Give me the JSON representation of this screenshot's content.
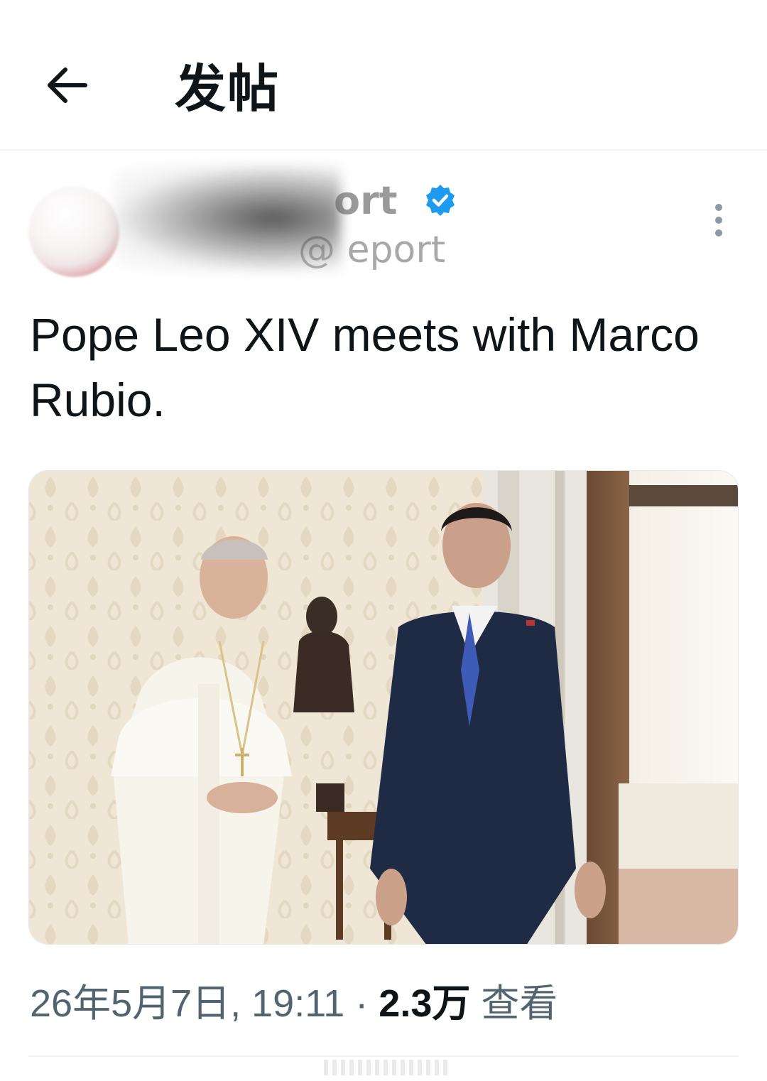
{
  "header": {
    "title": "发帖"
  },
  "author": {
    "name_partial": "ort",
    "handle_partial": "@        eport",
    "verified": true
  },
  "post": {
    "text": "Pope Leo XIV meets with Marco Rubio."
  },
  "meta": {
    "date": "26年5月7日, 19:11",
    "separator": "·",
    "views_count": "2.3万",
    "views_label": "查看"
  },
  "colors": {
    "accent": "#1d9bf0",
    "text_primary": "#0f1419",
    "text_secondary": "#536471",
    "divider": "#eff3f4"
  },
  "icons": {
    "back": "arrow-left-icon",
    "verified": "verified-badge-icon",
    "more": "more-vertical-icon"
  }
}
